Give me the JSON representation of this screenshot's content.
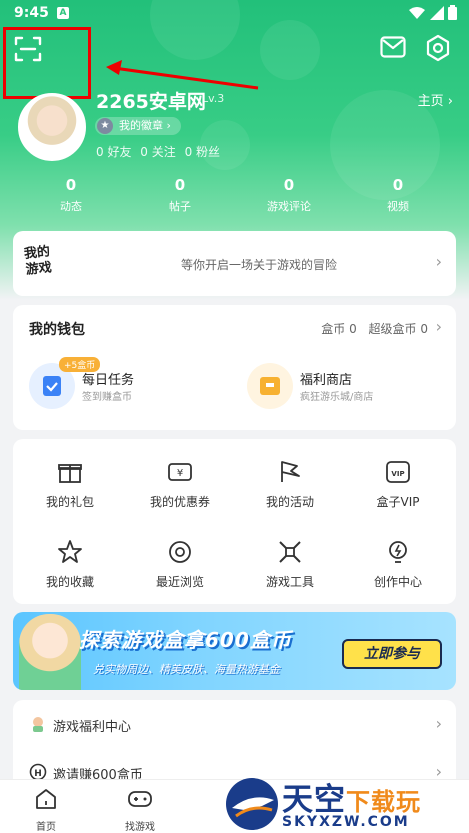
{
  "status_bar": {
    "time": "9:45",
    "sim_label": "A"
  },
  "profile": {
    "username": "2265安卓网",
    "level": "Lv.3",
    "homepage_label": "主页 ›",
    "badge_label": "我的徽章 ›",
    "friends": "0 好友",
    "following": "0 关注",
    "fans": "0 粉丝"
  },
  "stats": [
    {
      "value": "0",
      "label": "动态"
    },
    {
      "value": "0",
      "label": "帖子"
    },
    {
      "value": "0",
      "label": "游戏评论"
    },
    {
      "value": "0",
      "label": "视频"
    }
  ],
  "my_games": {
    "logo_line1": "我的",
    "logo_line2": "游戏",
    "slogan": "等你开启一场关于游戏的冒险"
  },
  "wallet": {
    "title": "我的钱包",
    "coins": "盒币 0",
    "super_coins": "超级盒币 0",
    "tasks": [
      {
        "title": "每日任务",
        "subtitle": "签到赚盒币",
        "tag": "+5盒币"
      },
      {
        "title": "福利商店",
        "subtitle": "疯狂游乐城/商店"
      }
    ]
  },
  "grid_items": [
    {
      "label": "我的礼包",
      "icon": "gift-icon"
    },
    {
      "label": "我的优惠券",
      "icon": "coupon-icon"
    },
    {
      "label": "我的活动",
      "icon": "flag-icon"
    },
    {
      "label": "盒子VIP",
      "icon": "vip-icon"
    },
    {
      "label": "我的收藏",
      "icon": "star-icon"
    },
    {
      "label": "最近浏览",
      "icon": "eye-icon"
    },
    {
      "label": "游戏工具",
      "icon": "tools-icon"
    },
    {
      "label": "创作中心",
      "icon": "bulb-icon"
    }
  ],
  "banner": {
    "headline": "探索游戏盒拿600盒币",
    "subline": "兑实物周边、精美皮肤、海量热游基金",
    "cta": "立即参与"
  },
  "links": [
    {
      "label": "游戏福利中心"
    },
    {
      "label": "邀请赚600盒币"
    }
  ],
  "tabs": [
    {
      "label": "首页"
    },
    {
      "label": "找游戏"
    }
  ],
  "watermark": {
    "main": "天空",
    "accent": "下载玩",
    "url": "SKYXZW.COM"
  },
  "colors": {
    "brand_green": "#2cc47d",
    "highlight_red": "#e00000",
    "orange_tag": "#f8b037"
  }
}
